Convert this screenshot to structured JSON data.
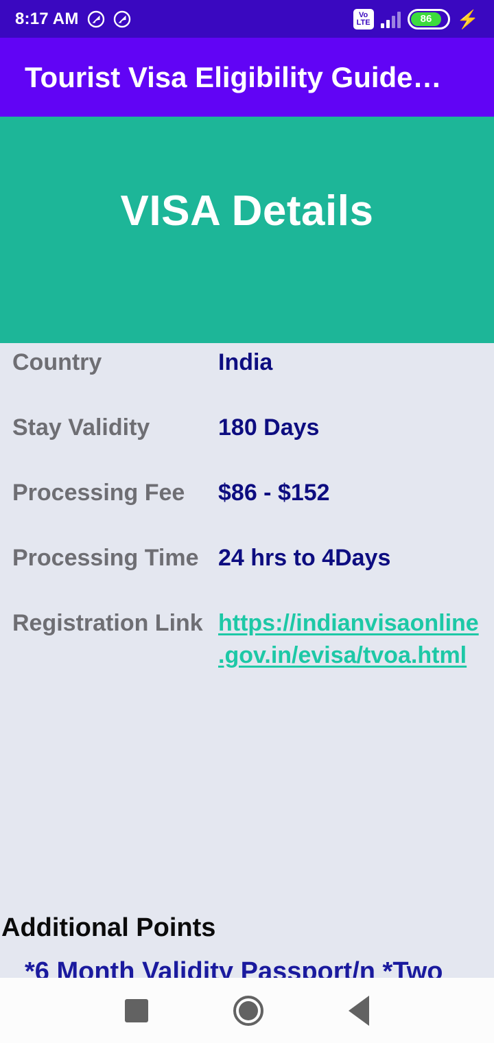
{
  "status_bar": {
    "time": "8:17 AM",
    "notification_icons": [
      "notification-circle-icon",
      "notification-circle-icon"
    ],
    "network_label_top": "Vo",
    "network_label_bottom": "LTE",
    "signal_icon": "signal-bars-icon",
    "battery_percent": "86",
    "charging_icon": "charging-bolt-icon",
    "background_color": "#3A08C0"
  },
  "app_bar": {
    "title": "Tourist Visa Eligibility Guide…",
    "background_color": "#6104F5"
  },
  "hero": {
    "title": "VISA Details",
    "background_color": "#1DB698"
  },
  "details": {
    "rows": [
      {
        "label": "Country",
        "value": "India",
        "is_link": false
      },
      {
        "label": "Stay Validity",
        "value": "180 Days",
        "is_link": false
      },
      {
        "label": "Processing Fee",
        "value": "$86 - $152",
        "is_link": false
      },
      {
        "label": "Processing Time",
        "value": "24 hrs to 4Days",
        "is_link": false
      },
      {
        "label": "Registration Link",
        "value": "https://indianvisaonline.gov.in/evisa/tvoa.html",
        "is_link": true
      }
    ],
    "label_color": "#6E6E73",
    "value_color": "#0D0D80",
    "link_color": "#1DC8A6"
  },
  "additional_points": {
    "heading": "Additional Points",
    "body": "*6 Month Validity Passport/n *Two"
  },
  "nav_bar": {
    "recents_icon": "square-recents-icon",
    "home_icon": "circle-home-icon",
    "back_icon": "triangle-back-icon"
  },
  "page": {
    "background_color": "#E4E7F0"
  }
}
